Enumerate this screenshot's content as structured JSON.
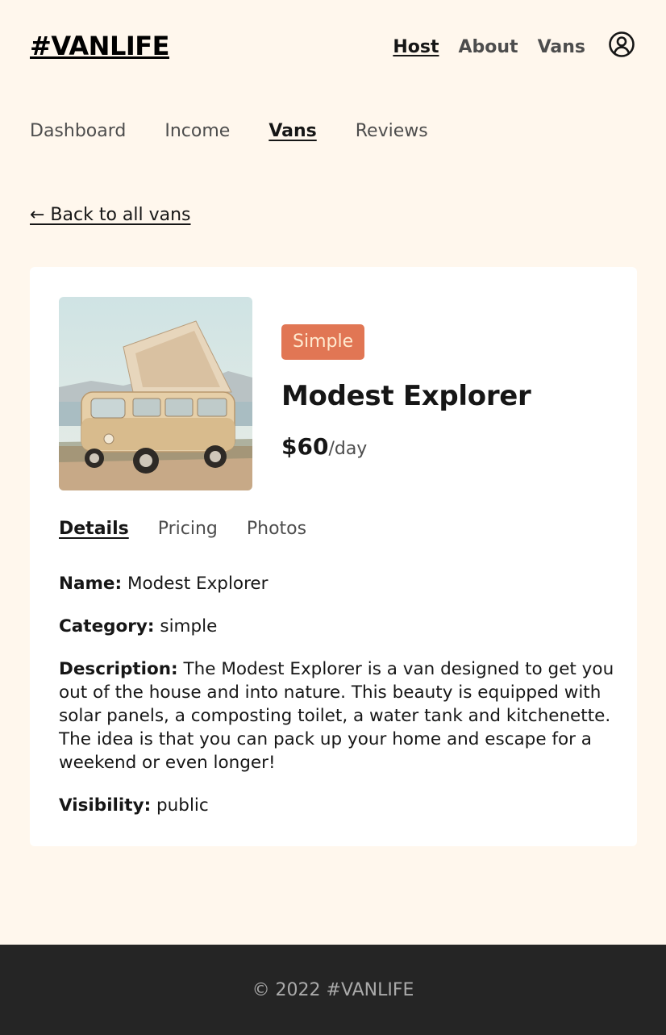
{
  "header": {
    "logo": "#VANLIFE",
    "nav": [
      "Host",
      "About",
      "Vans"
    ],
    "active_nav": "Host",
    "profile_icon": "user-circle-icon"
  },
  "host_nav": {
    "items": [
      "Dashboard",
      "Income",
      "Vans",
      "Reviews"
    ],
    "active": "Vans"
  },
  "back_link": "← Back to all vans",
  "van": {
    "type_badge": "Simple",
    "badge_color": "#E17654",
    "name": "Modest Explorer",
    "price": "$60",
    "price_unit": "/day",
    "image_icon": "camper-van-photo"
  },
  "detail_tabs": {
    "items": [
      "Details",
      "Pricing",
      "Photos"
    ],
    "active": "Details"
  },
  "details": {
    "name_label": "Name:",
    "name_value": "Modest Explorer",
    "category_label": "Category:",
    "category_value": "simple",
    "description_label": "Description:",
    "description_value": "The Modest Explorer is a van designed to get you out of the house and into nature. This beauty is equipped with solar panels, a composting toilet, a water tank and kitchenette. The idea is that you can pack up your home and escape for a weekend or even longer!",
    "visibility_label": "Visibility:",
    "visibility_value": "public"
  },
  "footer": {
    "text": "© 2022 #VANLIFE"
  }
}
